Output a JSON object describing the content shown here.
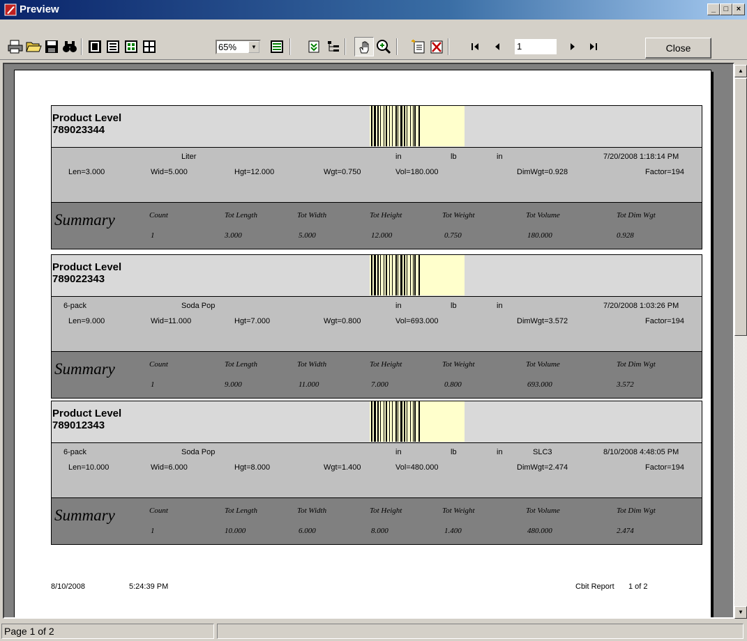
{
  "window": {
    "title": "Preview"
  },
  "toolbar": {
    "zoom_value": "65%",
    "page_number": "1",
    "close_label": "Close"
  },
  "status": {
    "text": "Page 1 of 2"
  },
  "report": {
    "records": [
      {
        "level_label": "Product Level",
        "code": "789023344",
        "row1": {
          "pkg": "",
          "unit": "Liter",
          "in1": "in",
          "lb": "lb",
          "in2": "in",
          "code2": "",
          "timestamp": "7/20/2008 1:18:14 PM"
        },
        "row2": {
          "len": "Len=3.000",
          "wid": "Wid=5.000",
          "hgt": "Hgt=12.000",
          "wgt": "Wgt=0.750",
          "vol": "Vol=180.000",
          "dim": "DimWgt=0.928",
          "factor": "Factor=194"
        },
        "summary": {
          "title": "Summary",
          "headers": [
            "Count",
            "Tot Length",
            "Tot Width",
            "Tot Height",
            "Tot Weight",
            "Tot Volume",
            "Tot Dim Wgt"
          ],
          "values": [
            "1",
            "3.000",
            "5.000",
            "12.000",
            "0.750",
            "180.000",
            "0.928"
          ]
        }
      },
      {
        "level_label": "Product Level",
        "code": "789022343",
        "row1": {
          "pkg": "6-pack",
          "unit": "Soda Pop",
          "in1": "in",
          "lb": "lb",
          "in2": "in",
          "code2": "",
          "timestamp": "7/20/2008 1:03:26 PM"
        },
        "row2": {
          "len": "Len=9.000",
          "wid": "Wid=11.000",
          "hgt": "Hgt=7.000",
          "wgt": "Wgt=0.800",
          "vol": "Vol=693.000",
          "dim": "DimWgt=3.572",
          "factor": "Factor=194"
        },
        "summary": {
          "title": "Summary",
          "headers": [
            "Count",
            "Tot Length",
            "Tot Width",
            "Tot Height",
            "Tot Weight",
            "Tot Volume",
            "Tot Dim Wgt"
          ],
          "values": [
            "1",
            "9.000",
            "11.000",
            "7.000",
            "0.800",
            "693.000",
            "3.572"
          ]
        }
      },
      {
        "level_label": "Product Level",
        "code": "789012343",
        "row1": {
          "pkg": "6-pack",
          "unit": "Soda Pop",
          "in1": "in",
          "lb": "lb",
          "in2": "in",
          "code2": "SLC3",
          "timestamp": "8/10/2008 4:48:05 PM"
        },
        "row2": {
          "len": "Len=10.000",
          "wid": "Wid=6.000",
          "hgt": "Hgt=8.000",
          "wgt": "Wgt=1.400",
          "vol": "Vol=480.000",
          "dim": "DimWgt=2.474",
          "factor": "Factor=194"
        },
        "summary": {
          "title": "Summary",
          "headers": [
            "Count",
            "Tot Length",
            "Tot Width",
            "Tot Height",
            "Tot Weight",
            "Tot Volume",
            "Tot Dim Wgt"
          ],
          "values": [
            "1",
            "10.000",
            "6.000",
            "8.000",
            "1.400",
            "480.000",
            "2.474"
          ]
        }
      }
    ],
    "footer": {
      "date": "8/10/2008",
      "time": "5:24:39 PM",
      "report_name": "Cbit Report",
      "page": "1 of 2"
    }
  },
  "icons": {
    "print": "printer-icon",
    "open": "folder-open-icon",
    "save": "floppy-disk-icon",
    "find": "binoculars-icon",
    "single_page": "single-page-icon",
    "two_pages": "two-pages-icon",
    "four_pages": "four-pages-icon",
    "multi_pages": "multi-pages-icon",
    "page_width": "page-width-icon",
    "expand": "expand-icon",
    "tree": "tree-icon",
    "hand": "hand-icon",
    "zoom": "zoom-in-icon",
    "new_page": "new-page-icon",
    "delete_page": "delete-page-icon",
    "first": "first-page-icon",
    "prev": "prev-page-icon",
    "next": "next-page-icon",
    "last": "last-page-icon"
  },
  "colors": {
    "title_dark": "#0a246a",
    "header_gray": "#d9d9d9",
    "detail_gray": "#c0c0c0",
    "summary_gray": "#808080",
    "barcode_bg": "#ffffcc"
  }
}
